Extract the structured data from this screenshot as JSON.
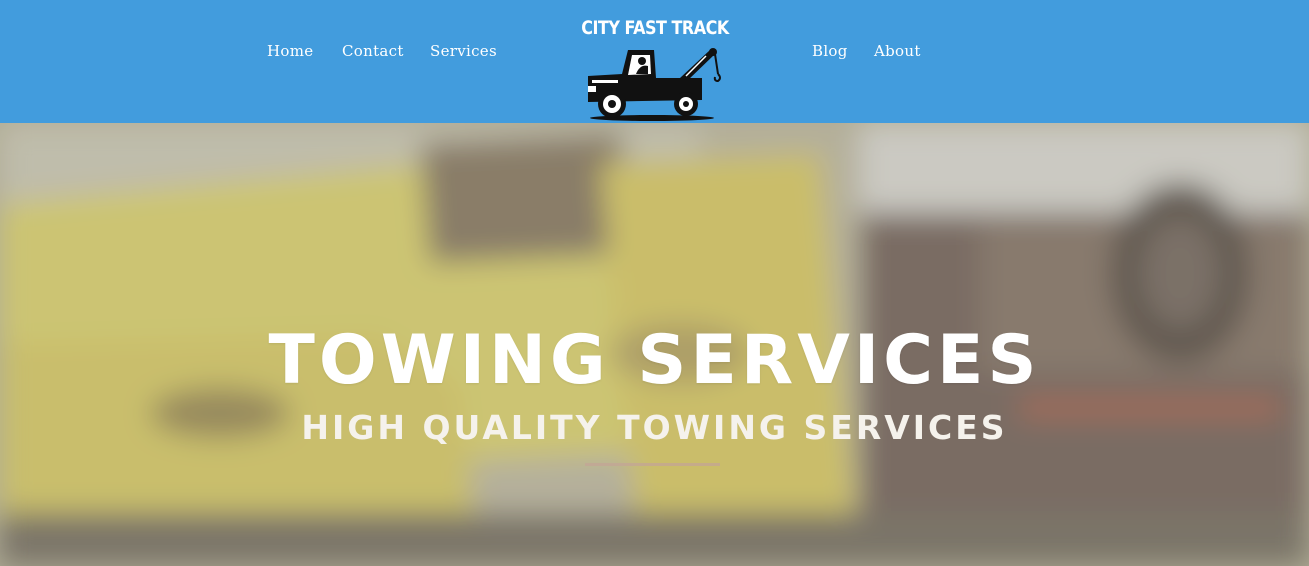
{
  "header": {
    "background_color": "#429cdd",
    "nav_left": [
      {
        "label": "Home"
      },
      {
        "label": "Contact"
      },
      {
        "label": "Services"
      }
    ],
    "nav_right": [
      {
        "label": "Blog"
      },
      {
        "label": "About"
      }
    ],
    "logo": {
      "text": "CITY FAST TRACK",
      "icon": "tow-truck-icon"
    }
  },
  "hero": {
    "title": "TOWING SERVICES",
    "subtitle": "HIGH QUALITY TOWING SERVICES",
    "background": "blurred-yellow-tow-truck-photo",
    "divider_color": "#c3a695"
  }
}
